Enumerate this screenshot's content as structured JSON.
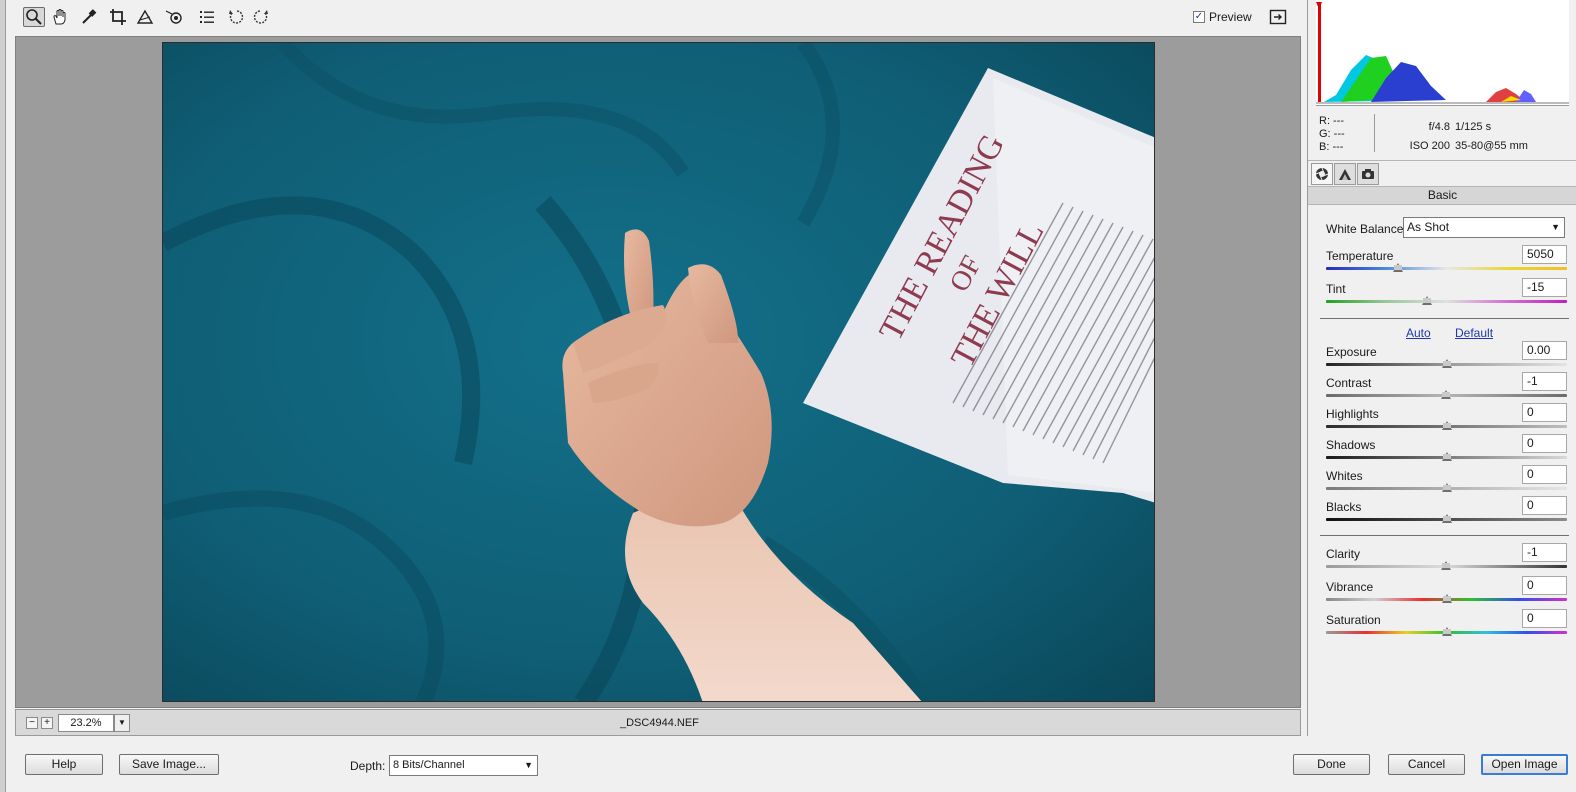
{
  "toolbar": {
    "tools": [
      "zoom-icon",
      "hand-icon",
      "white-balance-icon",
      "crop-icon",
      "straighten-icon",
      "redeye-icon",
      "preferences-list-icon",
      "rotate-left-icon",
      "rotate-right-icon"
    ],
    "preview_label": "Preview",
    "preview_checked": true
  },
  "photo": {
    "paper_title_line1": "THE READING",
    "paper_title_line2": "OF",
    "paper_title_line3": "THE WILL"
  },
  "status": {
    "zoom_minus": "−",
    "zoom_plus": "+",
    "zoom_value": "23.2%",
    "filename": "_DSC4944.NEF"
  },
  "readout": {
    "r": "R:  ---",
    "g": "G:  ---",
    "b": "B:  ---",
    "aperture": "f/4.8",
    "shutter": "1/125 s",
    "iso": "ISO 200",
    "lens": "35-80@55 mm"
  },
  "panel": {
    "title": "Basic",
    "wb_label": "White Balance:",
    "wb_value": "As Shot",
    "auto_label": "Auto",
    "default_label": "Default",
    "sliders": [
      {
        "label": "Temperature",
        "value": "5050",
        "pos": 0.3
      },
      {
        "label": "Tint",
        "value": "-15",
        "pos": 0.42
      },
      {
        "label": "Exposure",
        "value": "0.00",
        "pos": 0.5
      },
      {
        "label": "Contrast",
        "value": "-1",
        "pos": 0.497
      },
      {
        "label": "Highlights",
        "value": "0",
        "pos": 0.5
      },
      {
        "label": "Shadows",
        "value": "0",
        "pos": 0.5
      },
      {
        "label": "Whites",
        "value": "0",
        "pos": 0.5
      },
      {
        "label": "Blacks",
        "value": "0",
        "pos": 0.5
      },
      {
        "label": "Clarity",
        "value": "-1",
        "pos": 0.497
      },
      {
        "label": "Vibrance",
        "value": "0",
        "pos": 0.5
      },
      {
        "label": "Saturation",
        "value": "0",
        "pos": 0.5
      }
    ]
  },
  "bottom": {
    "help": "Help",
    "save": "Save Image...",
    "depth_label": "Depth:",
    "depth_value": "8 Bits/Channel",
    "done": "Done",
    "cancel": "Cancel",
    "open": "Open Image"
  }
}
